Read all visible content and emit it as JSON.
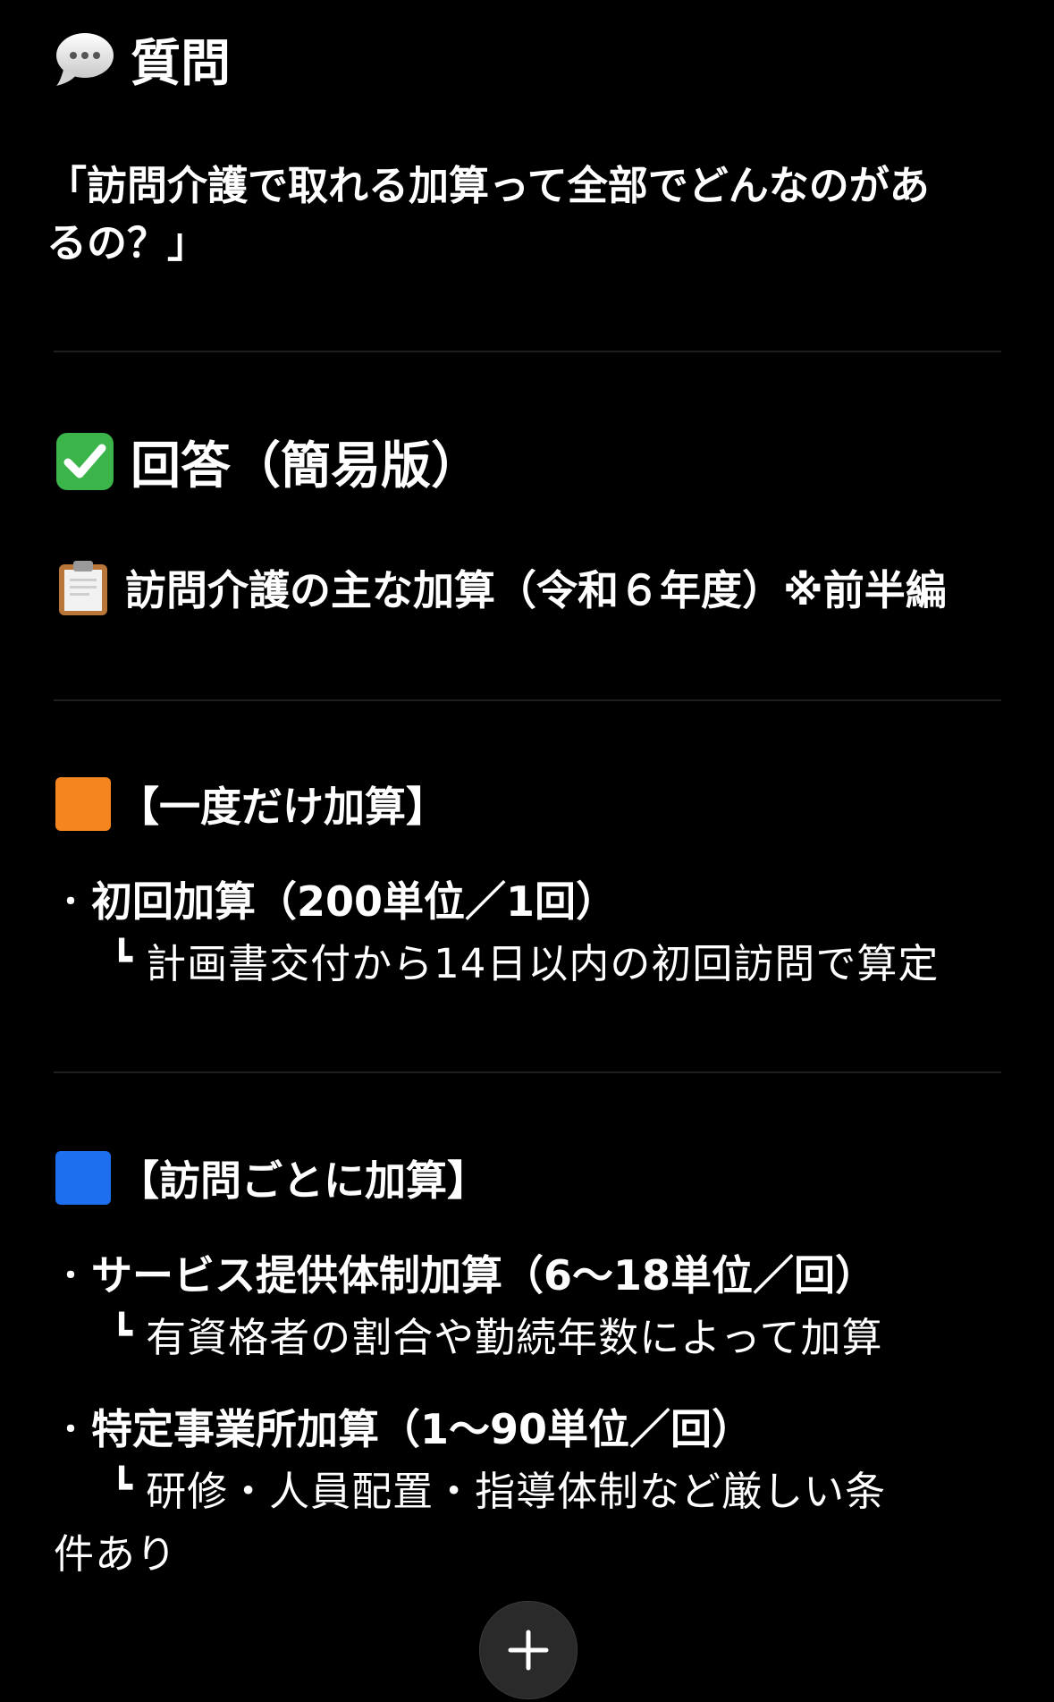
{
  "question": {
    "heading_icon": "speech-bubble-icon",
    "heading": "質問",
    "text_line1": "「訪問介護で取れる加算って全部でどんなのがあ",
    "text_line2": "るの？」"
  },
  "answer": {
    "heading_icon": "check-mark-icon",
    "heading": "回答（簡易版）"
  },
  "subtitle": {
    "icon": "clipboard-icon",
    "text": "訪問介護の主な加算（令和６年度）※前半編"
  },
  "sections": [
    {
      "icon": "orange-square-icon",
      "icon_color": "#F5861F",
      "heading": "【一度だけ加算】",
      "items": [
        {
          "bullet": "・",
          "title": "初回加算（200単位／1回）",
          "sub_prefix": "┗",
          "detail": "計画書交付から14日以内の初回訪問で算定"
        }
      ]
    },
    {
      "icon": "blue-square-icon",
      "icon_color": "#1E6FF0",
      "heading": "【訪問ごとに加算】",
      "items": [
        {
          "bullet": "・",
          "title": "サービス提供体制加算（6〜18単位／回）",
          "sub_prefix": "┗",
          "detail": "有資格者の割合や勤続年数によって加算"
        },
        {
          "bullet": "・",
          "title": "特定事業所加算（1〜90単位／回）",
          "sub_prefix": "┗",
          "detail_line1": "研修・人員配置・指導体制など厳しい条",
          "detail_line2": "件あり"
        }
      ]
    }
  ],
  "fab": {
    "icon": "plus-icon"
  }
}
